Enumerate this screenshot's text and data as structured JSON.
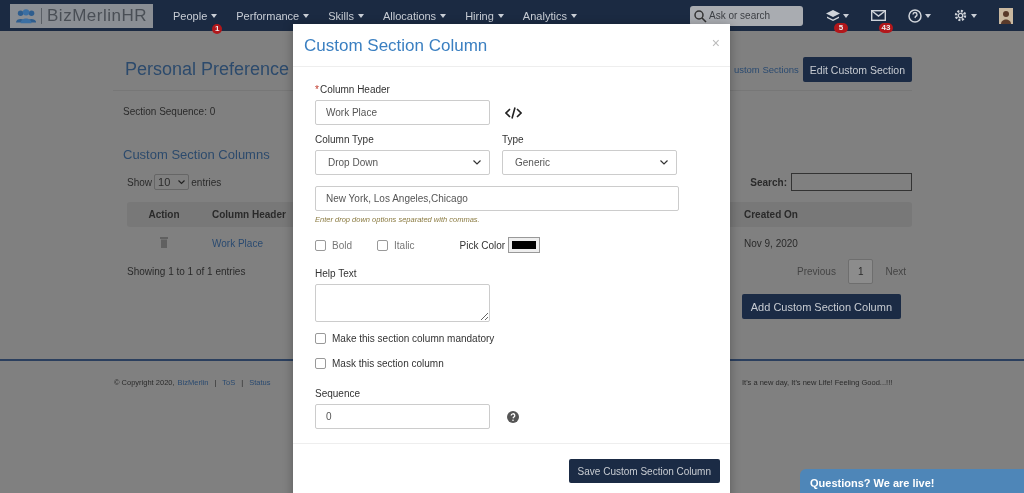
{
  "navbar": {
    "logo": "BizMerlinHR",
    "menu": [
      {
        "label": "People",
        "badge": "1"
      },
      {
        "label": "Performance"
      },
      {
        "label": "Skills"
      },
      {
        "label": "Allocations"
      },
      {
        "label": "Hiring"
      },
      {
        "label": "Analytics"
      }
    ],
    "search": {
      "placeholder": "Ask or search"
    },
    "icons": [
      {
        "kind": "layers",
        "badge": "5"
      },
      {
        "kind": "mail",
        "badge": "43"
      },
      {
        "kind": "help"
      },
      {
        "kind": "settings"
      },
      {
        "kind": "avatar"
      }
    ]
  },
  "page": {
    "title": "Personal Preference",
    "link": "ustom Sections",
    "edit_button": "Edit Custom Section",
    "sequence": "Section Sequence: 0",
    "section_title": "Custom Section Columns",
    "length": {
      "before": "Show",
      "value": "10",
      "after": "entries"
    },
    "search_label": "Search:",
    "table": {
      "columns": [
        "Action",
        "Column Header",
        "Created On"
      ],
      "rows": [
        {
          "column_header": "Work Place",
          "created_on": "Nov 9, 2020"
        }
      ]
    },
    "info": "Showing 1 to 1 of 1 entries",
    "pagination": {
      "previous": "Previous",
      "pages": [
        {
          "label": "1",
          "selected": true
        }
      ],
      "next": "Next"
    },
    "add_button": "Add Custom Section Column"
  },
  "footer": {
    "copyright": "© Copyright 2020,",
    "company": "BizMerlin",
    "separator": "|",
    "links": [
      "ToS",
      "Status"
    ],
    "motto": "It's a new day, It's new Life! Feeling Good...!!!"
  },
  "modal": {
    "title": "Custom Section Column",
    "close": "×",
    "column_header": {
      "label": "Column Header",
      "required": true,
      "required_mark": "*",
      "value": "Work Place"
    },
    "column_type": {
      "label": "Column Type",
      "value": "Drop Down"
    },
    "type": {
      "label": "Type",
      "value": "Generic"
    },
    "options": {
      "value": "New York, Los Angeles,Chicago",
      "hint": "Enter drop down options separated with commas."
    },
    "styles": [
      {
        "label": "Bold",
        "checked": false
      },
      {
        "label": "Italic",
        "checked": false
      }
    ],
    "pick_color": {
      "label": "Pick Color",
      "color": "#000000"
    },
    "help_text": {
      "label": "Help Text"
    },
    "flags": [
      {
        "label": "Make this section column mandatory",
        "checked": false
      },
      {
        "label": "Mask this section column",
        "checked": false
      }
    ],
    "sequence": {
      "label": "Sequence",
      "value": "0"
    },
    "save_button": "Save Custom Section Column"
  },
  "chat": {
    "label": "Questions? We are live!"
  }
}
